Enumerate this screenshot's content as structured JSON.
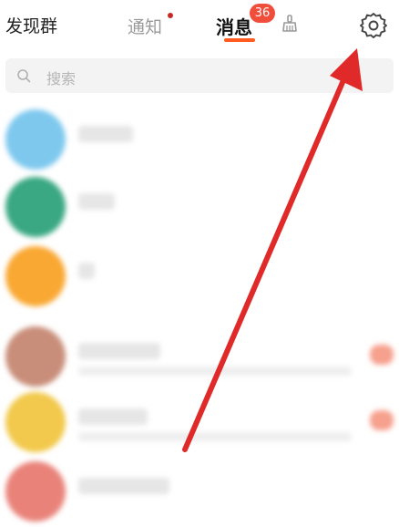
{
  "header": {
    "left_label": "发现群",
    "tab_notice": "通知",
    "tab_messages": "消息",
    "messages_badge": "36",
    "clean_icon": "broom-icon",
    "settings_icon": "gear-icon"
  },
  "search": {
    "placeholder": "搜索"
  },
  "colors": {
    "accent": "#ff5a1f",
    "badge": "#f04d3b",
    "annotation_arrow": "#e02a2a"
  },
  "conversations": [
    {
      "avatar_color": "#7ec8ee"
    },
    {
      "avatar_color": "#3aa882"
    },
    {
      "avatar_color": "#f9a833"
    },
    {
      "avatar_color": "#c98e7a"
    },
    {
      "avatar_color": "#f2c94c"
    },
    {
      "avatar_color": "#e9837a"
    }
  ]
}
